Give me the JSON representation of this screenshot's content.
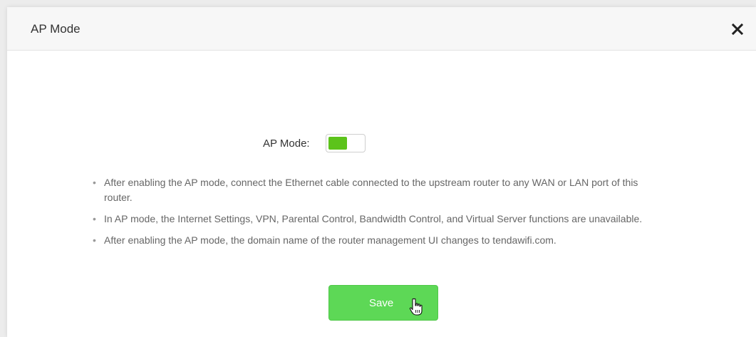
{
  "dialog": {
    "title": "AP Mode",
    "close_icon": "close-icon"
  },
  "ap_mode": {
    "label": "AP Mode:",
    "enabled": true,
    "accent_color": "#5cc31b"
  },
  "notes": [
    "After enabling the AP mode, connect the Ethernet cable connected to the upstream router to any WAN or LAN port of this router.",
    "In AP mode, the Internet Settings, VPN, Parental Control, Bandwidth Control, and Virtual Server functions are unavailable.",
    "After enabling the AP mode, the domain name of the router management UI changes to tendawifi.com."
  ],
  "save_button": {
    "label": "Save",
    "color": "#5dd856",
    "cursor_icon": "hand-pointer-icon"
  }
}
